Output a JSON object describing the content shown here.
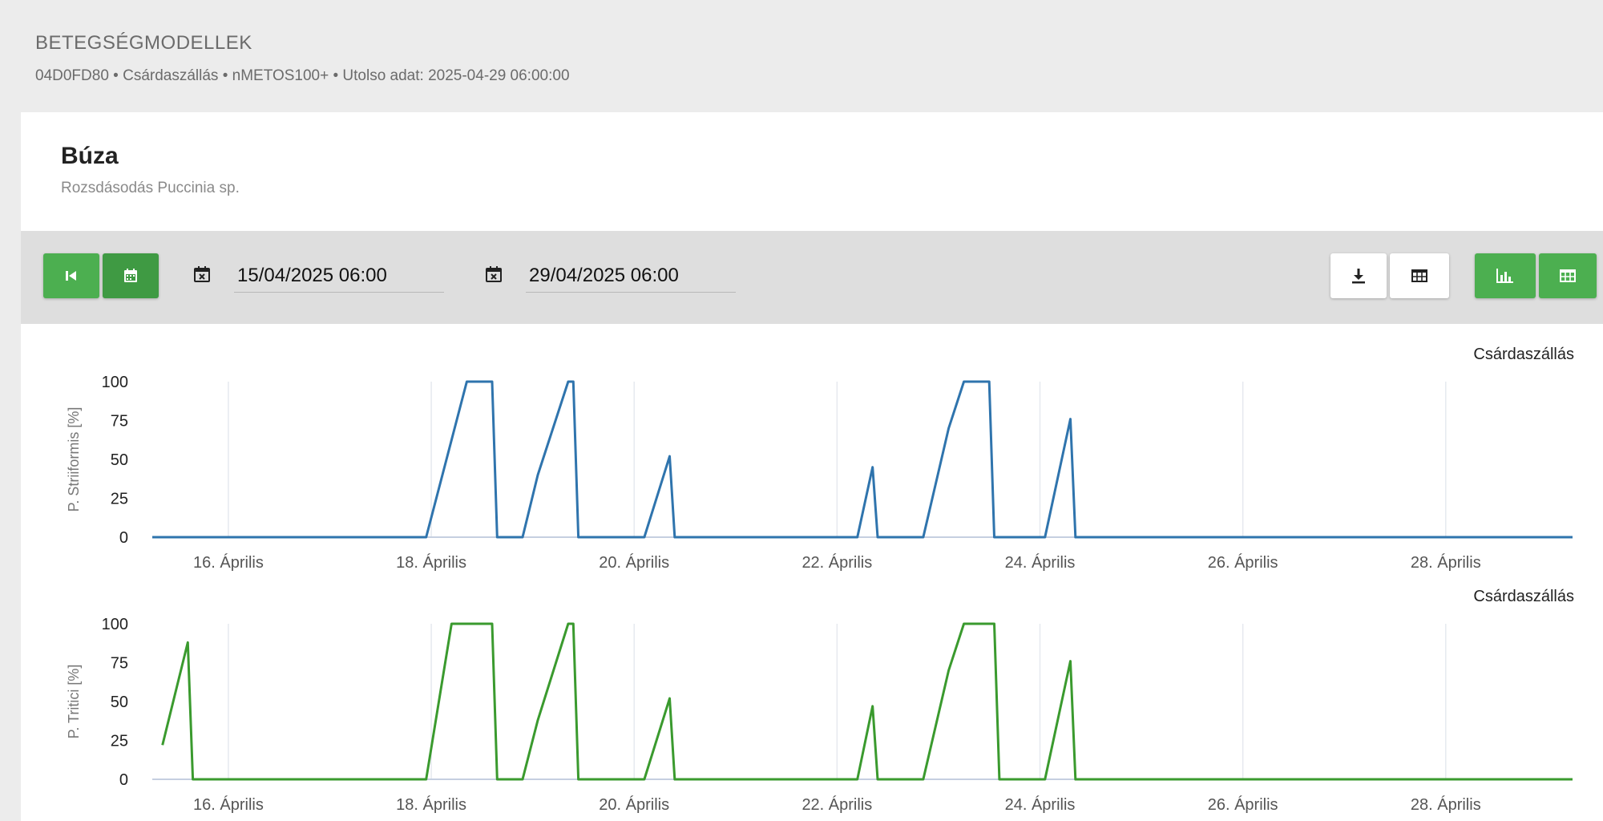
{
  "header": {
    "title": "BETEGSÉGMODELLEK",
    "subtitle": "04D0FD80 • Csárdaszállás • nMETOS100+ • Utolso adat: 2025-04-29 06:00:00"
  },
  "card": {
    "crop": "Búza",
    "disease": "Rozsdásodás Puccinia sp."
  },
  "toolbar": {
    "start_date": "15/04/2025 06:00",
    "end_date": "29/04/2025 06:00",
    "icons": {
      "first": "skip-to-start-icon",
      "calendar": "calendar-icon",
      "download": "download-icon",
      "table": "table-icon",
      "bar_chart": "bar-chart-icon",
      "grid": "grid-icon"
    }
  },
  "colors": {
    "accent_green": "#4caf50",
    "series_blue": "#2f74ad",
    "series_green": "#3a9a2e"
  },
  "chart_data": [
    {
      "type": "line",
      "legend": "Csárdaszállás",
      "ylabel": "P. Striiformis [%]",
      "ylim": [
        0,
        100
      ],
      "yticks": [
        0,
        25,
        50,
        75,
        100
      ],
      "xticks": [
        "16. Április",
        "18. Április",
        "20. Április",
        "22. Április",
        "24. Április",
        "26. Április",
        "28. Április"
      ],
      "xlim_days": [
        15.25,
        29.25
      ],
      "color": "#2f74ad",
      "points": [
        [
          15.25,
          0
        ],
        [
          17.95,
          0
        ],
        [
          18.35,
          100
        ],
        [
          18.6,
          100
        ],
        [
          18.65,
          0
        ],
        [
          18.9,
          0
        ],
        [
          19.05,
          40
        ],
        [
          19.35,
          100
        ],
        [
          19.4,
          100
        ],
        [
          19.45,
          0
        ],
        [
          20.1,
          0
        ],
        [
          20.35,
          52
        ],
        [
          20.4,
          0
        ],
        [
          22.2,
          0
        ],
        [
          22.35,
          45
        ],
        [
          22.4,
          0
        ],
        [
          22.85,
          0
        ],
        [
          23.1,
          70
        ],
        [
          23.25,
          100
        ],
        [
          23.5,
          100
        ],
        [
          23.55,
          0
        ],
        [
          24.05,
          0
        ],
        [
          24.3,
          76
        ],
        [
          24.35,
          0
        ],
        [
          29.25,
          0
        ]
      ]
    },
    {
      "type": "line",
      "legend": "Csárdaszállás",
      "ylabel": "P. Tritici [%]",
      "ylim": [
        0,
        100
      ],
      "yticks": [
        0,
        25,
        50,
        75,
        100
      ],
      "xticks": [
        "16. Április",
        "18. Április",
        "20. Április",
        "22. Április",
        "24. Április",
        "26. Április",
        "28. Április"
      ],
      "xlim_days": [
        15.25,
        29.25
      ],
      "color": "#3a9a2e",
      "points": [
        [
          15.35,
          22
        ],
        [
          15.6,
          88
        ],
        [
          15.65,
          0
        ],
        [
          17.95,
          0
        ],
        [
          18.2,
          100
        ],
        [
          18.6,
          100
        ],
        [
          18.65,
          0
        ],
        [
          18.9,
          0
        ],
        [
          19.05,
          38
        ],
        [
          19.35,
          100
        ],
        [
          19.4,
          100
        ],
        [
          19.45,
          0
        ],
        [
          20.1,
          0
        ],
        [
          20.35,
          52
        ],
        [
          20.4,
          0
        ],
        [
          22.2,
          0
        ],
        [
          22.35,
          47
        ],
        [
          22.4,
          0
        ],
        [
          22.85,
          0
        ],
        [
          23.1,
          70
        ],
        [
          23.25,
          100
        ],
        [
          23.55,
          100
        ],
        [
          23.6,
          0
        ],
        [
          24.05,
          0
        ],
        [
          24.3,
          76
        ],
        [
          24.35,
          0
        ],
        [
          29.25,
          0
        ]
      ]
    }
  ]
}
